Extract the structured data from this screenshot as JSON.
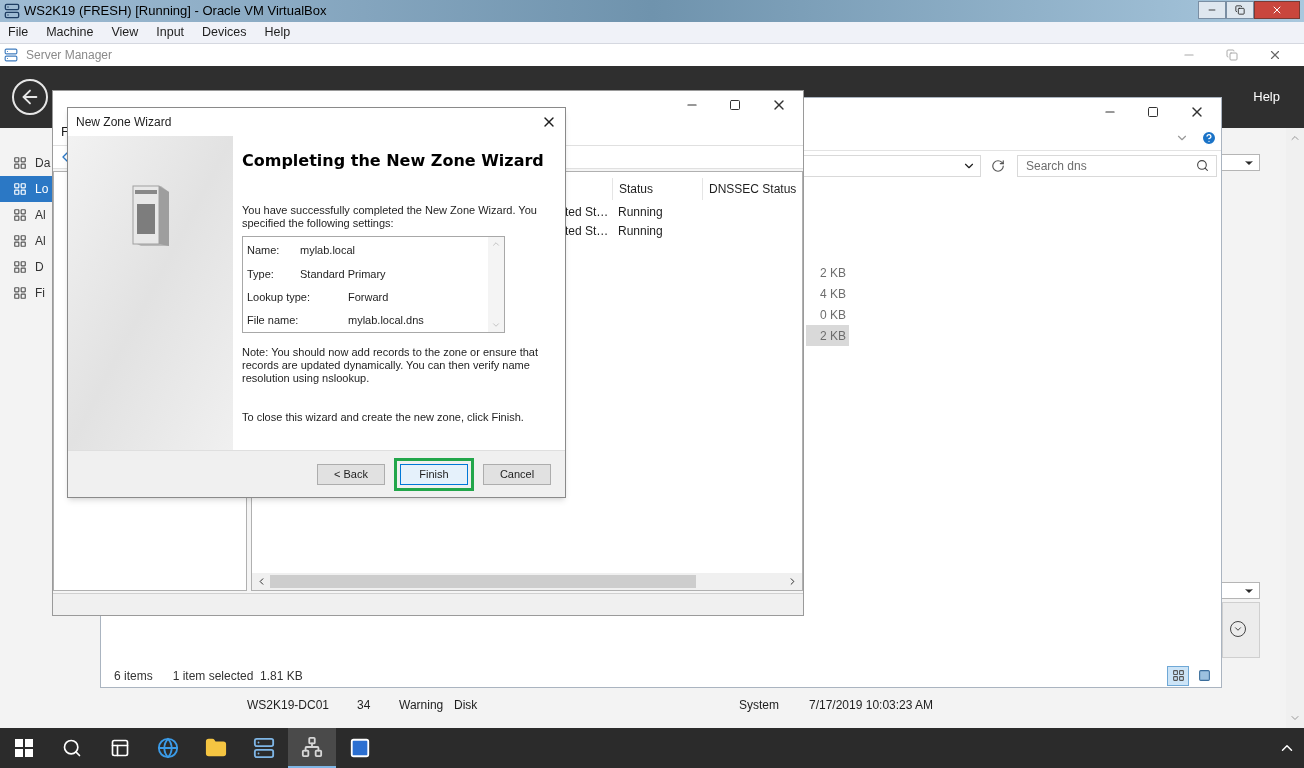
{
  "vm_window": {
    "title": "WS2K19 (FRESH) [Running] - Oracle VM VirtualBox",
    "menu": [
      "File",
      "Machine",
      "View",
      "Input",
      "Devices",
      "Help"
    ]
  },
  "server_manager": {
    "title": "Server Manager",
    "header_menu": [
      "Help"
    ],
    "sidebar": [
      {
        "label": "Da",
        "selected": false
      },
      {
        "label": "Lo",
        "selected": true
      },
      {
        "label": "Al",
        "selected": false
      },
      {
        "label": "Al",
        "selected": false
      },
      {
        "label": "D",
        "selected": false
      },
      {
        "label": "Fi",
        "selected": false
      }
    ]
  },
  "explorer": {
    "search": {
      "placeholder": "Search dns"
    },
    "file_sizes": [
      {
        "size": "2 KB",
        "selected": false
      },
      {
        "size": "4 KB",
        "selected": false
      },
      {
        "size": "0 KB",
        "selected": false
      },
      {
        "size": "2 KB",
        "selected": true
      }
    ],
    "status": [
      "6 items",
      "1 item selected  1.81 KB"
    ],
    "view_buttons": [
      {
        "kind": "details",
        "selected": true
      },
      {
        "kind": "preview",
        "selected": false
      }
    ]
  },
  "dns_manager": {
    "menu_fragment": "F",
    "columns": [
      "Status",
      "DNSSEC Status"
    ],
    "rows": [
      {
        "type_fragment": "ted St…",
        "status": "Running"
      },
      {
        "type_fragment": "ted St…",
        "status": "Running"
      }
    ]
  },
  "wizard": {
    "title": "New Zone Wizard",
    "heading": "Completing the New Zone Wizard",
    "intro": "You have successfully completed the New Zone Wizard. You specified the following settings:",
    "settings": [
      {
        "label": "Name:",
        "value": "mylab.local",
        "kind": "short"
      },
      {
        "label": "Type:",
        "value": "Standard Primary",
        "kind": "short"
      },
      {
        "label": "Lookup type:",
        "value": "Forward",
        "kind": "long"
      },
      {
        "label": "File name:",
        "value": "mylab.local.dns",
        "kind": "long"
      }
    ],
    "note": "Note: You should now add records to the zone or ensure that records are updated dynamically. You can then verify name resolution using nslookup.",
    "closing": "To close this wizard and create the new zone, click Finish.",
    "buttons": [
      {
        "label": "< Back",
        "focused": false
      },
      {
        "label": "Finish",
        "focused": true
      },
      {
        "label": "Cancel",
        "focused": false
      }
    ]
  },
  "events": [
    {
      "server": "WS2K19-DC01",
      "id": "34",
      "severity": "Warning",
      "source": "Disk",
      "log": "System",
      "date": "7/17/2019 10:03:23 AM"
    }
  ],
  "taskbar": [
    {
      "kind": "start",
      "active": false
    },
    {
      "kind": "search",
      "active": false
    },
    {
      "kind": "taskview",
      "active": false
    },
    {
      "kind": "browser",
      "active": false
    },
    {
      "kind": "folder",
      "active": false
    },
    {
      "kind": "servermanager",
      "active": false
    },
    {
      "kind": "dns",
      "active": true
    },
    {
      "kind": "powershell",
      "active": false
    }
  ]
}
